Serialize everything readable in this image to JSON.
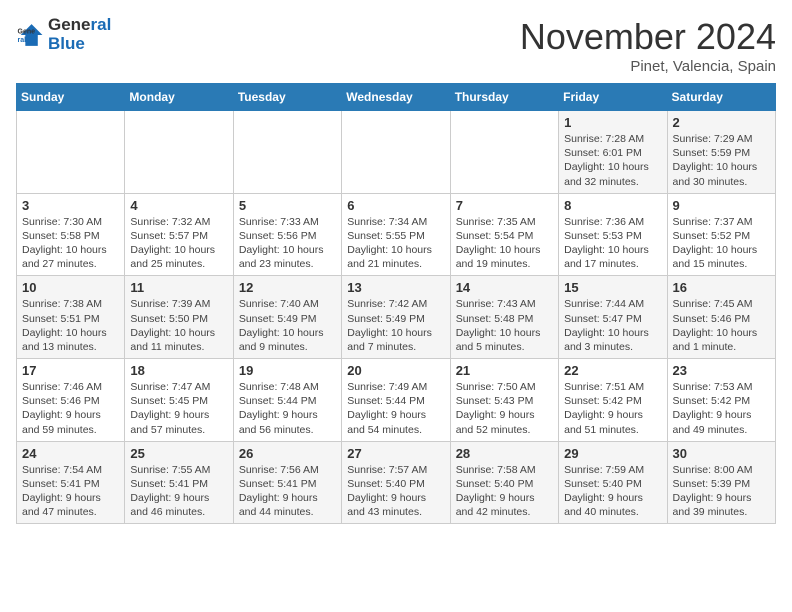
{
  "header": {
    "logo_line1": "General",
    "logo_line2": "Blue",
    "month": "November 2024",
    "location": "Pinet, Valencia, Spain"
  },
  "weekdays": [
    "Sunday",
    "Monday",
    "Tuesday",
    "Wednesday",
    "Thursday",
    "Friday",
    "Saturday"
  ],
  "weeks": [
    [
      {
        "day": "",
        "info": ""
      },
      {
        "day": "",
        "info": ""
      },
      {
        "day": "",
        "info": ""
      },
      {
        "day": "",
        "info": ""
      },
      {
        "day": "",
        "info": ""
      },
      {
        "day": "1",
        "info": "Sunrise: 7:28 AM\nSunset: 6:01 PM\nDaylight: 10 hours and 32 minutes."
      },
      {
        "day": "2",
        "info": "Sunrise: 7:29 AM\nSunset: 5:59 PM\nDaylight: 10 hours and 30 minutes."
      }
    ],
    [
      {
        "day": "3",
        "info": "Sunrise: 7:30 AM\nSunset: 5:58 PM\nDaylight: 10 hours and 27 minutes."
      },
      {
        "day": "4",
        "info": "Sunrise: 7:32 AM\nSunset: 5:57 PM\nDaylight: 10 hours and 25 minutes."
      },
      {
        "day": "5",
        "info": "Sunrise: 7:33 AM\nSunset: 5:56 PM\nDaylight: 10 hours and 23 minutes."
      },
      {
        "day": "6",
        "info": "Sunrise: 7:34 AM\nSunset: 5:55 PM\nDaylight: 10 hours and 21 minutes."
      },
      {
        "day": "7",
        "info": "Sunrise: 7:35 AM\nSunset: 5:54 PM\nDaylight: 10 hours and 19 minutes."
      },
      {
        "day": "8",
        "info": "Sunrise: 7:36 AM\nSunset: 5:53 PM\nDaylight: 10 hours and 17 minutes."
      },
      {
        "day": "9",
        "info": "Sunrise: 7:37 AM\nSunset: 5:52 PM\nDaylight: 10 hours and 15 minutes."
      }
    ],
    [
      {
        "day": "10",
        "info": "Sunrise: 7:38 AM\nSunset: 5:51 PM\nDaylight: 10 hours and 13 minutes."
      },
      {
        "day": "11",
        "info": "Sunrise: 7:39 AM\nSunset: 5:50 PM\nDaylight: 10 hours and 11 minutes."
      },
      {
        "day": "12",
        "info": "Sunrise: 7:40 AM\nSunset: 5:49 PM\nDaylight: 10 hours and 9 minutes."
      },
      {
        "day": "13",
        "info": "Sunrise: 7:42 AM\nSunset: 5:49 PM\nDaylight: 10 hours and 7 minutes."
      },
      {
        "day": "14",
        "info": "Sunrise: 7:43 AM\nSunset: 5:48 PM\nDaylight: 10 hours and 5 minutes."
      },
      {
        "day": "15",
        "info": "Sunrise: 7:44 AM\nSunset: 5:47 PM\nDaylight: 10 hours and 3 minutes."
      },
      {
        "day": "16",
        "info": "Sunrise: 7:45 AM\nSunset: 5:46 PM\nDaylight: 10 hours and 1 minute."
      }
    ],
    [
      {
        "day": "17",
        "info": "Sunrise: 7:46 AM\nSunset: 5:46 PM\nDaylight: 9 hours and 59 minutes."
      },
      {
        "day": "18",
        "info": "Sunrise: 7:47 AM\nSunset: 5:45 PM\nDaylight: 9 hours and 57 minutes."
      },
      {
        "day": "19",
        "info": "Sunrise: 7:48 AM\nSunset: 5:44 PM\nDaylight: 9 hours and 56 minutes."
      },
      {
        "day": "20",
        "info": "Sunrise: 7:49 AM\nSunset: 5:44 PM\nDaylight: 9 hours and 54 minutes."
      },
      {
        "day": "21",
        "info": "Sunrise: 7:50 AM\nSunset: 5:43 PM\nDaylight: 9 hours and 52 minutes."
      },
      {
        "day": "22",
        "info": "Sunrise: 7:51 AM\nSunset: 5:42 PM\nDaylight: 9 hours and 51 minutes."
      },
      {
        "day": "23",
        "info": "Sunrise: 7:53 AM\nSunset: 5:42 PM\nDaylight: 9 hours and 49 minutes."
      }
    ],
    [
      {
        "day": "24",
        "info": "Sunrise: 7:54 AM\nSunset: 5:41 PM\nDaylight: 9 hours and 47 minutes."
      },
      {
        "day": "25",
        "info": "Sunrise: 7:55 AM\nSunset: 5:41 PM\nDaylight: 9 hours and 46 minutes."
      },
      {
        "day": "26",
        "info": "Sunrise: 7:56 AM\nSunset: 5:41 PM\nDaylight: 9 hours and 44 minutes."
      },
      {
        "day": "27",
        "info": "Sunrise: 7:57 AM\nSunset: 5:40 PM\nDaylight: 9 hours and 43 minutes."
      },
      {
        "day": "28",
        "info": "Sunrise: 7:58 AM\nSunset: 5:40 PM\nDaylight: 9 hours and 42 minutes."
      },
      {
        "day": "29",
        "info": "Sunrise: 7:59 AM\nSunset: 5:40 PM\nDaylight: 9 hours and 40 minutes."
      },
      {
        "day": "30",
        "info": "Sunrise: 8:00 AM\nSunset: 5:39 PM\nDaylight: 9 hours and 39 minutes."
      }
    ]
  ]
}
